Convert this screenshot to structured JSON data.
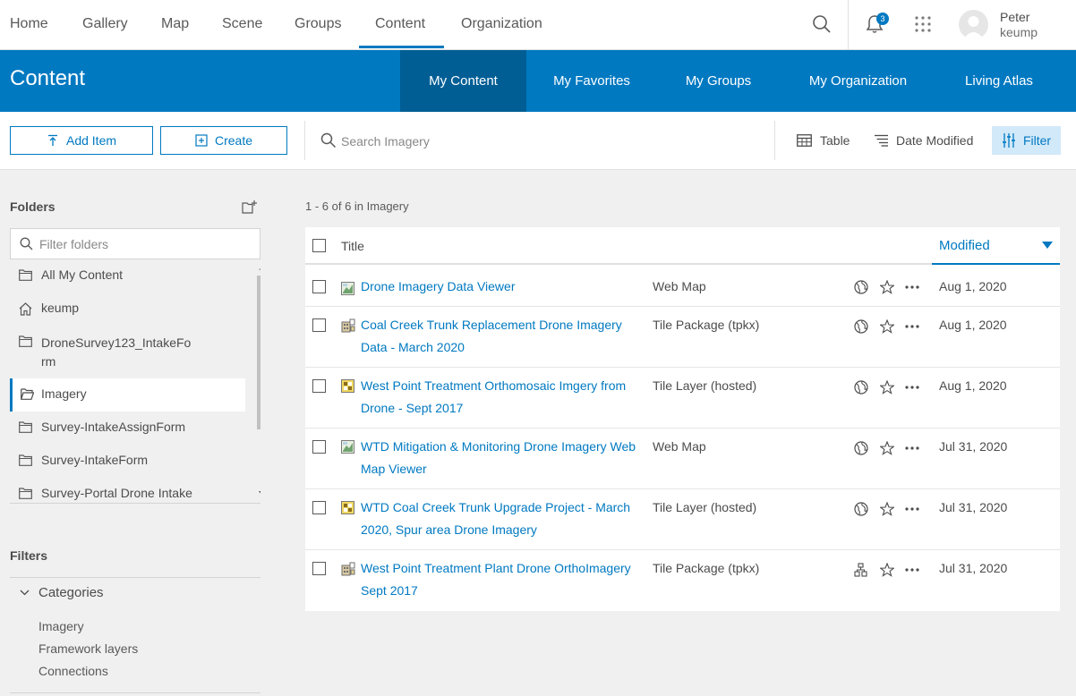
{
  "topnav": {
    "items": [
      {
        "label": "Home"
      },
      {
        "label": "Gallery"
      },
      {
        "label": "Map"
      },
      {
        "label": "Scene"
      },
      {
        "label": "Groups"
      },
      {
        "label": "Content"
      },
      {
        "label": "Organization"
      }
    ],
    "active": "Content",
    "notification_count": "3",
    "user": {
      "name": "Peter",
      "username": "keump"
    }
  },
  "banner": {
    "title": "Content",
    "tabs": [
      {
        "label": "My Content"
      },
      {
        "label": "My Favorites"
      },
      {
        "label": "My Groups"
      },
      {
        "label": "My Organization"
      },
      {
        "label": "Living Atlas"
      }
    ],
    "active_tab": "My Content"
  },
  "toolbar": {
    "add_item": "Add Item",
    "create": "Create",
    "search_placeholder": "Search Imagery",
    "view": "Table",
    "sort": "Date Modified",
    "filter": "Filter"
  },
  "sidebar": {
    "folders_title": "Folders",
    "filter_placeholder": "Filter folders",
    "folders": [
      {
        "label": "All My Content",
        "icon": "folder-icon"
      },
      {
        "label": "keump",
        "icon": "home-icon"
      },
      {
        "label": "DroneSurvey123_IntakeForm",
        "line1": "DroneSurvey123_IntakeFo",
        "line2": "rm",
        "icon": "folder-icon"
      },
      {
        "label": "Imagery",
        "icon": "folder-open-icon",
        "active": true
      },
      {
        "label": "Survey-IntakeAssignForm",
        "icon": "folder-icon"
      },
      {
        "label": "Survey-IntakeForm",
        "icon": "folder-icon"
      },
      {
        "label": "Survey-Portal Drone Intake",
        "icon": "folder-icon"
      }
    ],
    "filters_title": "Filters",
    "categories": {
      "title": "Categories",
      "items": [
        {
          "label": "Imagery"
        },
        {
          "label": "Framework layers"
        },
        {
          "label": "Connections"
        }
      ]
    }
  },
  "main": {
    "count": "1 - 6 of 6 in Imagery",
    "header": {
      "title": "Title",
      "modified": "Modified"
    },
    "rows": [
      {
        "title": "Drone Imagery Data Viewer",
        "type": "Web Map",
        "date": "Aug 1, 2020",
        "type_icon": "web-map-icon",
        "share_icon": "globe-icon"
      },
      {
        "title": "Coal Creek Trunk Replacement Drone Imagery Data - March 2020",
        "type": "Tile Package (tpkx)",
        "date": "Aug 1, 2020",
        "type_icon": "tile-package-icon",
        "share_icon": "globe-icon"
      },
      {
        "title": "West Point Treatment Orthomosaic Imgery from Drone - Sept 2017",
        "type": "Tile Layer (hosted)",
        "date": "Aug 1, 2020",
        "type_icon": "tile-layer-icon",
        "share_icon": "globe-icon"
      },
      {
        "title": "WTD Mitigation & Monitoring Drone Imagery Web Map Viewer",
        "type": "Web Map",
        "date": "Jul 31, 2020",
        "type_icon": "web-map-icon",
        "share_icon": "globe-icon"
      },
      {
        "title": "WTD Coal Creek Trunk Upgrade Project - March 2020, Spur area Drone Imagery",
        "type": "Tile Layer (hosted)",
        "date": "Jul 31, 2020",
        "type_icon": "tile-layer-icon",
        "share_icon": "globe-icon"
      },
      {
        "title": "West Point Treatment Plant Drone OrthoImagery Sept 2017",
        "type": "Tile Package (tpkx)",
        "date": "Jul 31, 2020",
        "type_icon": "tile-package-icon",
        "share_icon": "org-icon"
      }
    ]
  },
  "colors": {
    "accent": "#0079c1",
    "banner_active": "#005e95",
    "filter_bg": "#d2e9f9"
  }
}
